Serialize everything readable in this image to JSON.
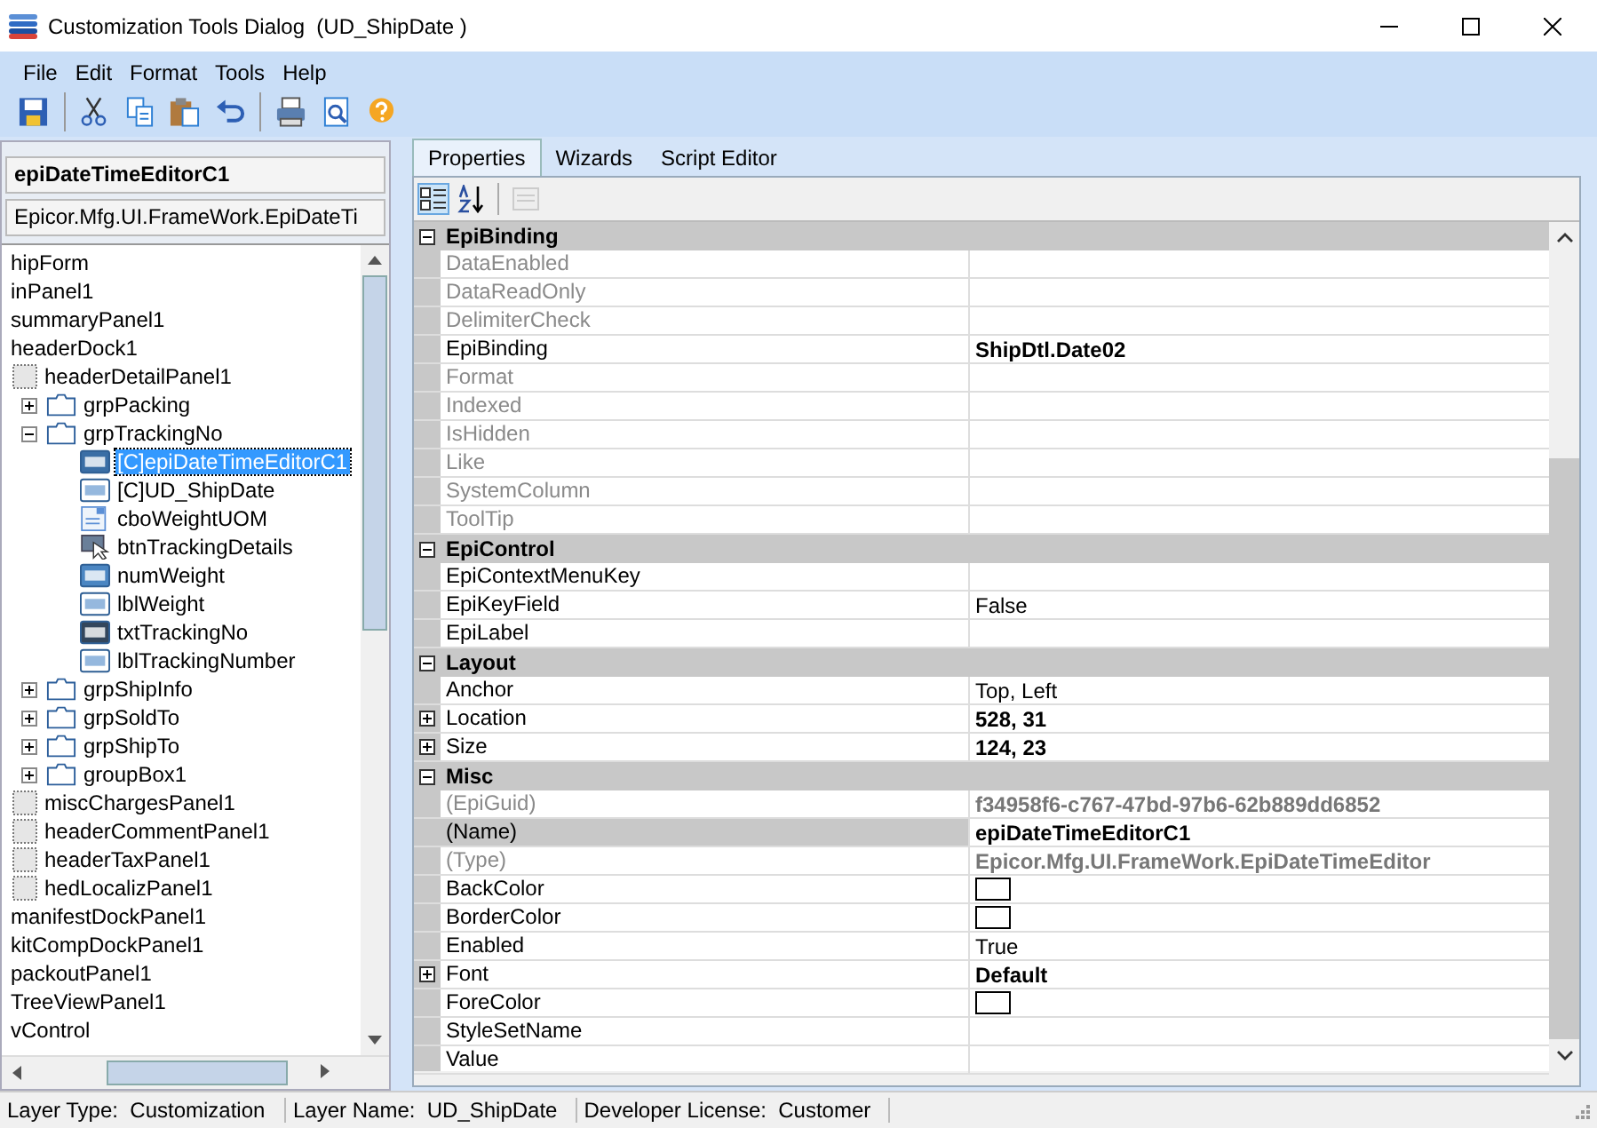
{
  "window": {
    "title": "Customization Tools Dialog  (UD_ShipDate )"
  },
  "menu": [
    "File",
    "Edit",
    "Format",
    "Tools",
    "Help"
  ],
  "toolbar": [
    {
      "kind": "save"
    },
    {
      "kind": "sep"
    },
    {
      "kind": "cut"
    },
    {
      "kind": "copy"
    },
    {
      "kind": "paste"
    },
    {
      "kind": "undo"
    },
    {
      "kind": "sep"
    },
    {
      "kind": "print"
    },
    {
      "kind": "preview"
    },
    {
      "kind": "help"
    }
  ],
  "selected_control": {
    "name": "epiDateTimeEditorC1",
    "type": "Epicor.Mfg.UI.FrameWork.EpiDateTi"
  },
  "tree": [
    {
      "label": "hipForm",
      "selected": false
    },
    {
      "label": "inPanel1",
      "selected": false
    },
    {
      "label": "summaryPanel1",
      "selected": false
    },
    {
      "label": "headerDock1",
      "selected": false,
      "children": [
        {
          "label": "headerDetailPanel1",
          "kind": "panel",
          "selected": false,
          "children": [
            {
              "label": "grpPacking",
              "kind": "group",
              "expanded": false,
              "selected": false
            },
            {
              "label": "grpTrackingNo",
              "kind": "group",
              "expanded": true,
              "selected": false,
              "children": [
                {
                  "label": "[C]epiDateTimeEditorC1",
                  "kind": "date",
                  "selected": true
                },
                {
                  "label": "[C]UD_ShipDate",
                  "kind": "text",
                  "selected": false
                },
                {
                  "label": "cboWeightUOM",
                  "kind": "combo",
                  "selected": false
                },
                {
                  "label": "btnTrackingDetails",
                  "kind": "button",
                  "selected": false
                },
                {
                  "label": "numWeight",
                  "kind": "number",
                  "selected": false
                },
                {
                  "label": "lblWeight",
                  "kind": "text",
                  "selected": false
                },
                {
                  "label": "txtTrackingNo",
                  "kind": "textdark",
                  "selected": false
                },
                {
                  "label": "lblTrackingNumber",
                  "kind": "text",
                  "selected": false
                }
              ]
            },
            {
              "label": "grpShipInfo",
              "kind": "group",
              "expanded": false,
              "selected": false
            },
            {
              "label": "grpSoldTo",
              "kind": "group",
              "expanded": false,
              "selected": false
            },
            {
              "label": "grpShipTo",
              "kind": "group",
              "expanded": false,
              "selected": false
            },
            {
              "label": "groupBox1",
              "kind": "group",
              "expanded": false,
              "selected": false
            }
          ]
        },
        {
          "label": "miscChargesPanel1",
          "kind": "panel",
          "selected": false
        },
        {
          "label": "headerCommentPanel1",
          "kind": "panel",
          "selected": false
        },
        {
          "label": "headerTaxPanel1",
          "kind": "panel",
          "selected": false
        },
        {
          "label": "hedLocalizPanel1",
          "kind": "panel",
          "selected": false
        }
      ]
    },
    {
      "label": "manifestDockPanel1",
      "selected": false
    },
    {
      "label": "kitCompDockPanel1",
      "selected": false
    },
    {
      "label": "packoutPanel1",
      "selected": false
    },
    {
      "label": "TreeViewPanel1",
      "selected": false
    },
    {
      "label": "vControl",
      "selected": false
    }
  ],
  "tabs": [
    {
      "label": "Properties",
      "selected": true
    },
    {
      "label": "Wizards",
      "selected": false
    },
    {
      "label": "Script Editor",
      "selected": false
    }
  ],
  "property_toolbar": [
    {
      "kind": "categorized",
      "selected": true,
      "disabled": false
    },
    {
      "kind": "alphabetical",
      "selected": false,
      "disabled": false
    },
    {
      "kind": "pages",
      "selected": false,
      "disabled": true
    }
  ],
  "categories": [
    {
      "name": "EpiBinding",
      "expanded": true,
      "rows": [
        {
          "name": "DataEnabled",
          "disabled": true,
          "selected": false
        },
        {
          "name": "DataReadOnly",
          "disabled": true,
          "selected": false
        },
        {
          "name": "DelimiterCheck",
          "disabled": true,
          "selected": false
        },
        {
          "name": "EpiBinding",
          "disabled": false,
          "value": "ShipDtl.Date02",
          "bold": true,
          "selected": false
        },
        {
          "name": "Format",
          "disabled": true,
          "selected": false
        },
        {
          "name": "Indexed",
          "disabled": true,
          "selected": false
        },
        {
          "name": "IsHidden",
          "disabled": true,
          "selected": false
        },
        {
          "name": "Like",
          "disabled": true,
          "selected": false
        },
        {
          "name": "SystemColumn",
          "disabled": true,
          "selected": false
        },
        {
          "name": "ToolTip",
          "disabled": true,
          "selected": false
        }
      ]
    },
    {
      "name": "EpiControl",
      "expanded": true,
      "rows": [
        {
          "name": "EpiContextMenuKey",
          "disabled": false,
          "selected": false
        },
        {
          "name": "EpiKeyField",
          "disabled": false,
          "value": "False",
          "selected": false
        },
        {
          "name": "EpiLabel",
          "disabled": false,
          "selected": false
        }
      ]
    },
    {
      "name": "Layout",
      "expanded": true,
      "rows": [
        {
          "name": "Anchor",
          "disabled": false,
          "value": "Top, Left",
          "selected": false
        },
        {
          "name": "Location",
          "disabled": false,
          "expandable": true,
          "value": "528, 31",
          "bold": true,
          "selected": false
        },
        {
          "name": "Size",
          "disabled": false,
          "expandable": true,
          "value": "124, 23",
          "bold": true,
          "selected": false
        }
      ]
    },
    {
      "name": "Misc",
      "expanded": true,
      "rows": [
        {
          "name": "(EpiGuid)",
          "disabled": true,
          "value": "f34958f6-c767-47bd-97b6-62b889dd6852",
          "bold": true,
          "selected": false
        },
        {
          "name": "(Name)",
          "disabled": false,
          "value": "epiDateTimeEditorC1",
          "bold": true,
          "selected": true
        },
        {
          "name": "(Type)",
          "disabled": true,
          "value": "Epicor.Mfg.UI.FrameWork.EpiDateTimeEditor",
          "bold": true,
          "selected": false
        },
        {
          "name": "BackColor",
          "disabled": false,
          "kind": "color",
          "color": "#ffffff",
          "selected": false
        },
        {
          "name": "BorderColor",
          "disabled": false,
          "kind": "color",
          "color": "#ffffff",
          "selected": false
        },
        {
          "name": "Enabled",
          "disabled": false,
          "value": "True",
          "selected": false
        },
        {
          "name": "Font",
          "disabled": false,
          "expandable": true,
          "value": "Default",
          "bold": true,
          "selected": false
        },
        {
          "name": "ForeColor",
          "disabled": false,
          "kind": "color",
          "color": "#ffffff",
          "selected": false
        },
        {
          "name": "StyleSetName",
          "disabled": false,
          "selected": false
        },
        {
          "name": "Value",
          "disabled": false,
          "selected": false
        }
      ]
    }
  ],
  "status_bar": [
    "Layer Type:  Customization",
    "Layer Name:  UD_ShipDate",
    "Developer License:  Customer"
  ]
}
